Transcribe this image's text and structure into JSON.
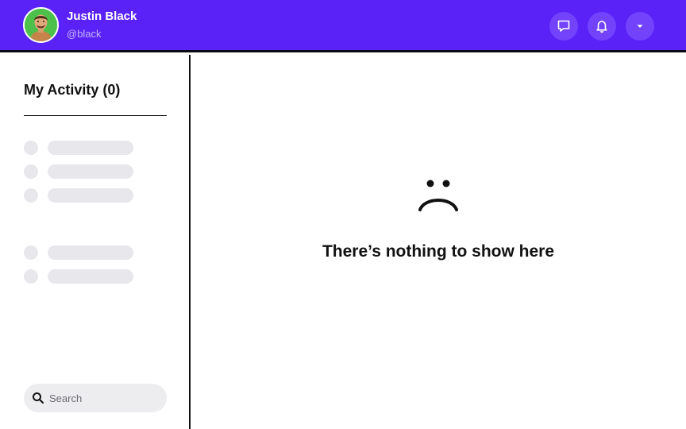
{
  "header": {
    "user_name": "Justin Black",
    "user_handle": "@black",
    "accent_color": "#5a22f7",
    "avatar_icon": "user-avatar",
    "actions": [
      {
        "icon": "message-icon"
      },
      {
        "icon": "bell-icon"
      },
      {
        "icon": "chevron-down-icon"
      }
    ]
  },
  "sidebar": {
    "title": "My Activity (0)",
    "placeholder_rows": 5,
    "search": {
      "placeholder": "Search",
      "value": "",
      "icon": "search-icon"
    }
  },
  "main": {
    "empty_icon": "sad-face-icon",
    "empty_message": "There’s nothing to show here"
  }
}
